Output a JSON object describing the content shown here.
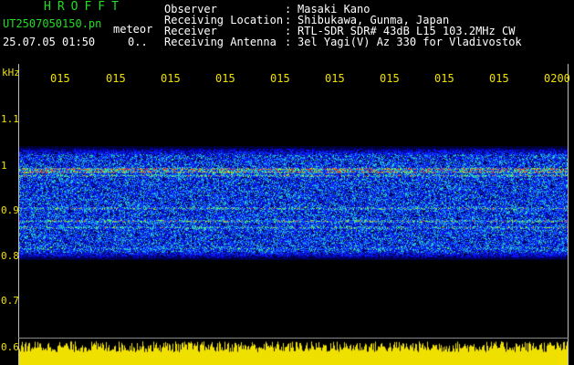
{
  "header": {
    "app_title": "HROFFT",
    "file_name": "UT2507050150.pn",
    "meteor_label": "meteor",
    "timestamp": "25.07.05 01:50",
    "count": "0..",
    "info": [
      {
        "key": "Observer",
        "sep": ":",
        "value": "Masaki Kano"
      },
      {
        "key": "Receiving Location",
        "sep": ":",
        "value": "Shibukawa, Gunma, Japan"
      },
      {
        "key": "Receiver",
        "sep": ":",
        "value": "RTL-SDR SDR# 43dB L15 103.2MHz CW"
      },
      {
        "key": "Receiving Antenna",
        "sep": ":",
        "value": "3el Yagi(V) Az 330 for Vladivostok"
      }
    ]
  },
  "plot": {
    "unit_label": "kHz",
    "y_ticks": [
      "1.1",
      "1",
      "0.9",
      "0.8",
      "0.7",
      "0.6"
    ],
    "x_ticks": [
      "015",
      "015",
      "015",
      "015",
      "015",
      "015",
      "015",
      "015",
      "015",
      "0200"
    ]
  },
  "colors": {
    "text_white": "#ffffff",
    "title_green": "#22dd22",
    "axis_yellow": "#f0e000",
    "background": "#000000",
    "noise_blue": "#1a2aff",
    "signal_red": "#ff2020",
    "signal_green": "#40ff60"
  }
}
